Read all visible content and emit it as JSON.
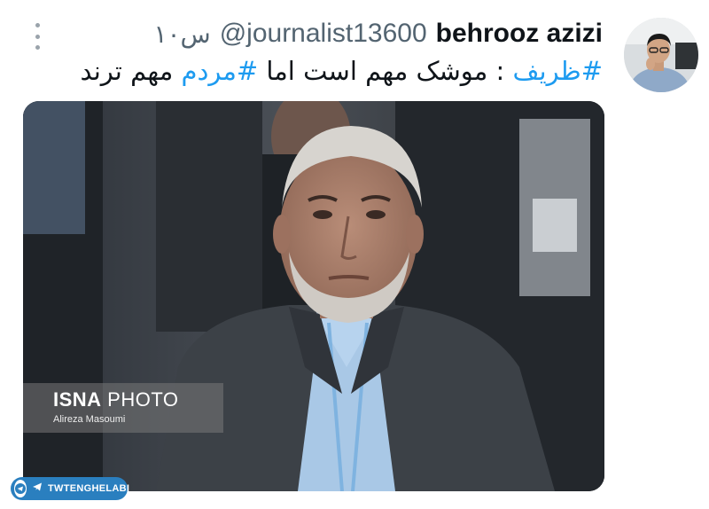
{
  "tweet": {
    "display_name": "behrooz azizi",
    "handle": "@journalist13600",
    "time": "۱۰س",
    "text_parts": [
      {
        "text": "#ظریف",
        "type": "hashtag"
      },
      {
        "text": " : موشک مهم است اما ",
        "type": "text"
      },
      {
        "text": "#مردم",
        "type": "hashtag"
      },
      {
        "text": " مهم ترند",
        "type": "text"
      }
    ]
  },
  "media": {
    "watermark_brand_bold": "ISNA",
    "watermark_brand_rest": " PHOTO",
    "watermark_credit": "Alireza Masoumi"
  },
  "channel_badge": {
    "text": "TWTENGHELABI",
    "icon": "telegram-icon"
  },
  "icons": {
    "more": "more-vertical-icon"
  },
  "colors": {
    "hashtag": "#1d9bf0",
    "secondary_text": "#536471",
    "badge_bg": "#2a7fbf"
  }
}
